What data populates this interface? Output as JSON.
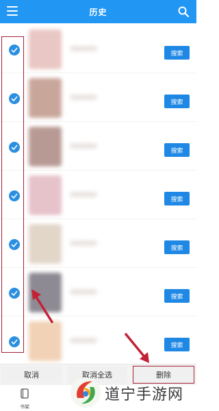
{
  "header": {
    "title": "历史",
    "menu_icon": "hamburger-menu-icon",
    "search_icon": "search-icon"
  },
  "list": {
    "items": [
      {
        "checked": true,
        "button_label": "搜索",
        "thumb_color": "#e9c7c4"
      },
      {
        "checked": true,
        "button_label": "搜索",
        "thumb_color": "#c9a69a"
      },
      {
        "checked": true,
        "button_label": "搜索",
        "thumb_color": "#b89a94"
      },
      {
        "checked": true,
        "button_label": "搜索",
        "thumb_color": "#e6c2cb"
      },
      {
        "checked": true,
        "button_label": "搜索",
        "thumb_color": "#e2d6c9"
      },
      {
        "checked": true,
        "button_label": "搜索",
        "thumb_color": "#8e8a93"
      },
      {
        "checked": true,
        "button_label": "搜索",
        "thumb_color": "#f1d2b6"
      }
    ]
  },
  "actions": {
    "cancel": "取消",
    "unselect_all": "取消全选",
    "delete": "删除"
  },
  "tabbar": {
    "bookshelf": "书架"
  },
  "watermark": {
    "text": "道宁手游网"
  },
  "colors": {
    "primary": "#2196f3",
    "button": "#1f88e5",
    "highlight": "#a32035"
  }
}
